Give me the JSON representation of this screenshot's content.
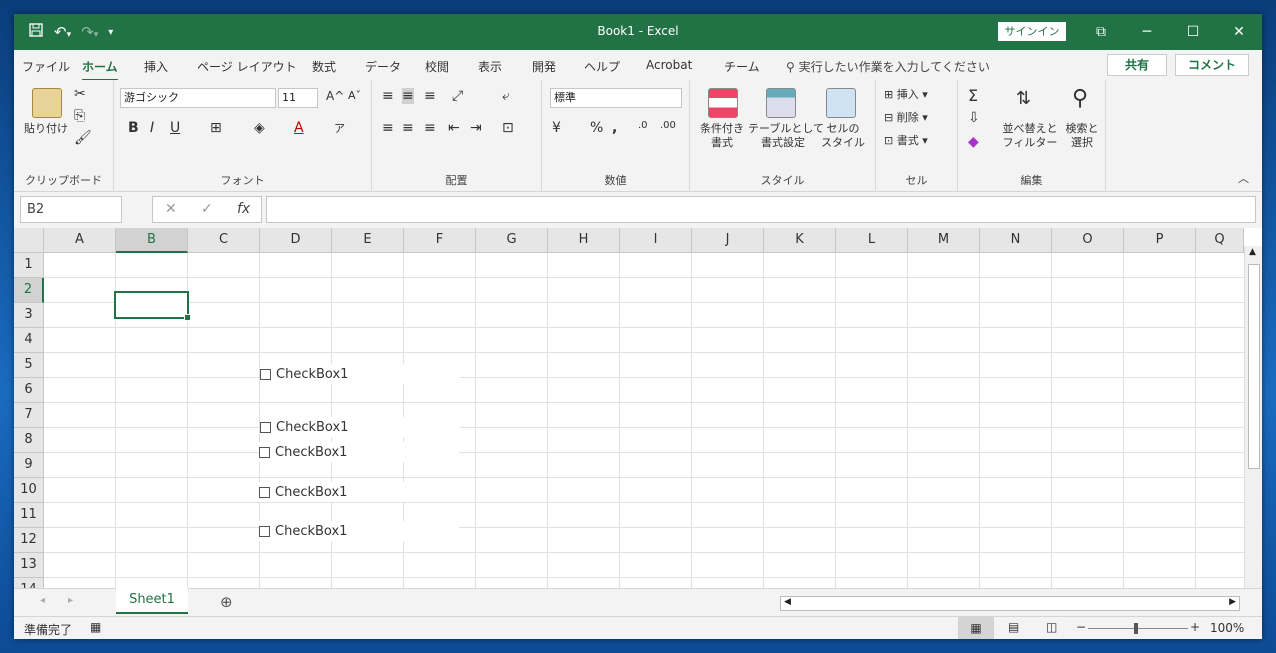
{
  "window": {
    "title": "Book1  -  Excel",
    "signin": "サインイン",
    "qat_icons": [
      "save-icon",
      "undo-icon",
      "redo-icon",
      "customize-icon"
    ]
  },
  "menu": {
    "tabs": [
      "ファイル",
      "ホーム",
      "挿入",
      "ページ レイアウト",
      "数式",
      "データ",
      "校閲",
      "表示",
      "開発",
      "ヘルプ",
      "Acrobat",
      "チーム"
    ],
    "active": "ホーム",
    "tellme": "実行したい作業を入力してください",
    "share": "共有",
    "comment": "コメント"
  },
  "ribbon": {
    "clipboard": {
      "paste": "貼り付け",
      "label": "クリップボード"
    },
    "font": {
      "name": "游ゴシック",
      "size": "11",
      "label": "フォント"
    },
    "alignment": {
      "label": "配置"
    },
    "number": {
      "format": "標準",
      "label": "数値"
    },
    "styles": {
      "conditional": "条件付き\n書式",
      "table": "テーブルとして\n書式設定",
      "cell": "セルの\nスタイル",
      "label": "スタイル"
    },
    "cells": {
      "insert": "挿入",
      "delete": "削除",
      "format": "書式",
      "label": "セル"
    },
    "editing": {
      "sort": "並べ替えと\nフィルター",
      "find": "検索と\n選択",
      "label": "編集"
    }
  },
  "formula_bar": {
    "name_box": "B2",
    "value": ""
  },
  "sheet": {
    "columns": [
      "A",
      "B",
      "C",
      "D",
      "E",
      "F",
      "G",
      "H",
      "I",
      "J",
      "K",
      "L",
      "M",
      "N",
      "O",
      "P",
      "Q"
    ],
    "rows": [
      "1",
      "2",
      "3",
      "4",
      "5",
      "6",
      "7",
      "8",
      "9",
      "10",
      "11",
      "12",
      "13",
      "14"
    ],
    "selected_col": "B",
    "selected_row": "2",
    "checkboxes": [
      "CheckBox1",
      "CheckBox1",
      "CheckBox1",
      "CheckBox1",
      "CheckBox1"
    ]
  },
  "sheet_tabs": {
    "active": "Sheet1"
  },
  "status": {
    "ready": "準備完了",
    "zoom": "100%"
  },
  "colors": {
    "accent": "#217346"
  }
}
